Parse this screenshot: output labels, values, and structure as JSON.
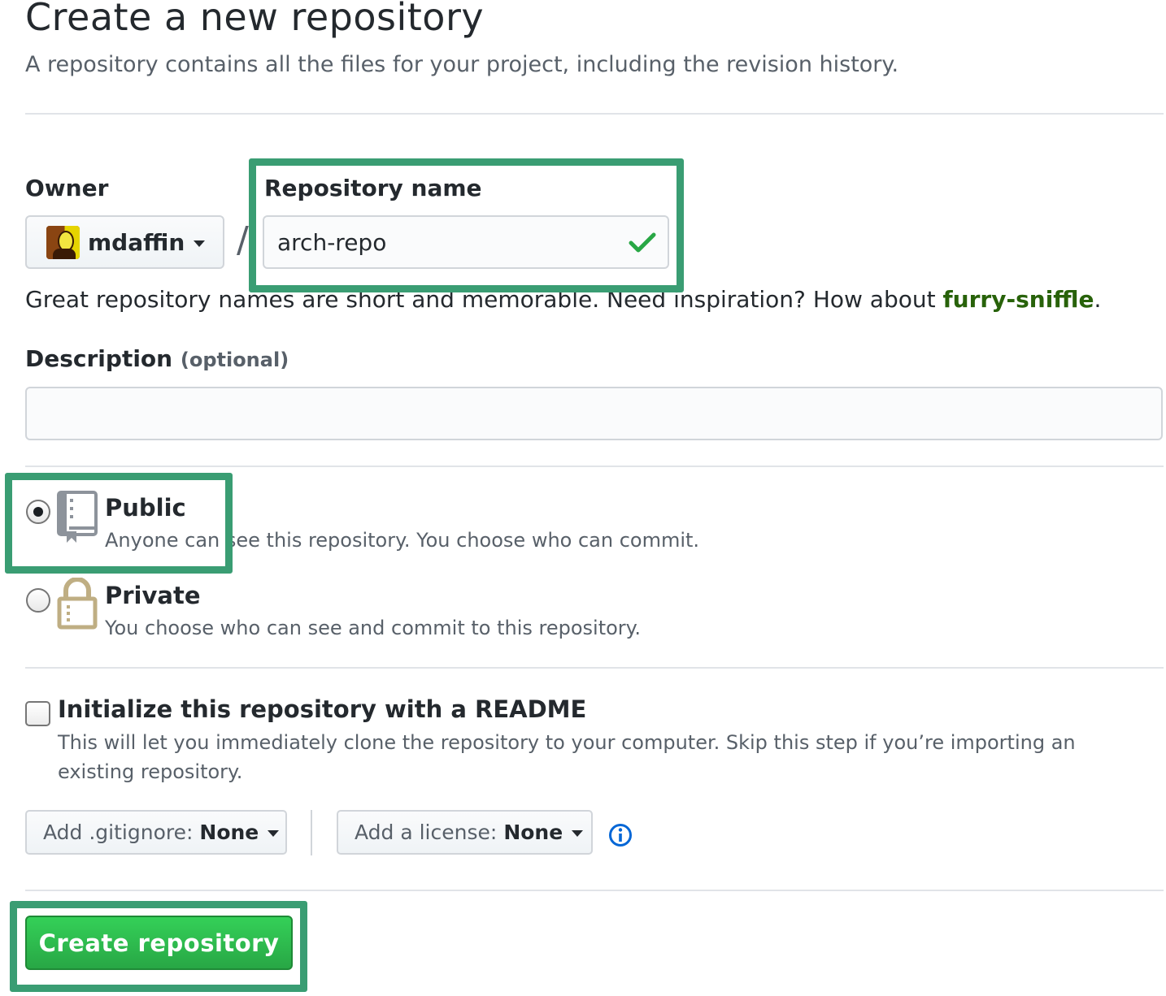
{
  "header": {
    "title": "Create a new repository",
    "subtitle": "A repository contains all the files for your project, including the revision history."
  },
  "owner": {
    "label": "Owner",
    "name": "mdaffin",
    "separator": "/"
  },
  "repository": {
    "label": "Repository name",
    "value": "arch-repo",
    "helper_prefix": "Great repository names are short and memorable. Need inspiration? How about ",
    "suggestion": "furry-sniffle",
    "helper_suffix": "."
  },
  "description": {
    "label": "Description",
    "optional": "(optional)",
    "value": ""
  },
  "visibility": {
    "selected": "public",
    "public": {
      "title": "Public",
      "desc": "Anyone can see this repository. You choose who can commit."
    },
    "private": {
      "title": "Private",
      "desc": "You choose who can see and commit to this repository."
    }
  },
  "readme": {
    "checked": false,
    "title": "Initialize this repository with a README",
    "desc": "This will let you immediately clone the repository to your computer. Skip this step if you’re importing an existing repository."
  },
  "gitignore": {
    "label": "Add .gitignore:",
    "value": "None"
  },
  "license": {
    "label": "Add a license:",
    "value": "None"
  },
  "submit": {
    "label": "Create repository"
  },
  "icons": {
    "validation": "checkmark-icon",
    "public": "repo-book-icon",
    "private": "lock-icon",
    "license_info": "info-icon",
    "dropdown": "caret-down-icon"
  },
  "colors": {
    "primary_button": "#28a745",
    "suggestion": "#28620a",
    "validation_check": "#28a745",
    "annotation_box": "#3a9d73",
    "info": "#0366d6"
  }
}
